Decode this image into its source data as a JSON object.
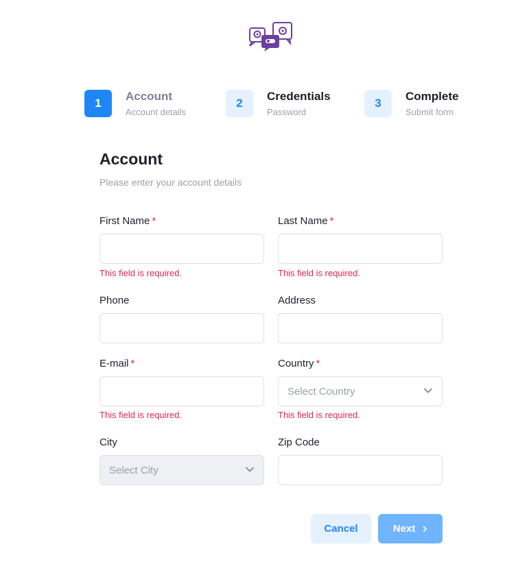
{
  "stepper": {
    "steps": [
      {
        "number": "1",
        "title": "Account",
        "subtitle": "Account details"
      },
      {
        "number": "2",
        "title": "Credentials",
        "subtitle": "Password"
      },
      {
        "number": "3",
        "title": "Complete",
        "subtitle": "Submit form"
      }
    ]
  },
  "form": {
    "title": "Account",
    "subtitle": "Please enter your account details",
    "required_marker": "*",
    "fields": {
      "first_name": {
        "label": "First Name",
        "value": "",
        "error": "This field is required."
      },
      "last_name": {
        "label": "Last Name",
        "value": "",
        "error": "This field is required."
      },
      "phone": {
        "label": "Phone",
        "value": ""
      },
      "address": {
        "label": "Address",
        "value": ""
      },
      "email": {
        "label": "E-mail",
        "value": "",
        "error": "This field is required."
      },
      "country": {
        "label": "Country",
        "placeholder": "Select Country",
        "error": "This field is required."
      },
      "city": {
        "label": "City",
        "placeholder": "Select City"
      },
      "zip": {
        "label": "Zip Code",
        "value": ""
      }
    }
  },
  "actions": {
    "cancel_label": "Cancel",
    "next_label": "Next"
  },
  "colors": {
    "primary": "#1f86f5",
    "primary_light": "#e5f1ff",
    "next_button": "#6fb4ff",
    "error": "#e2264d",
    "logo": "#6b3fa0"
  }
}
